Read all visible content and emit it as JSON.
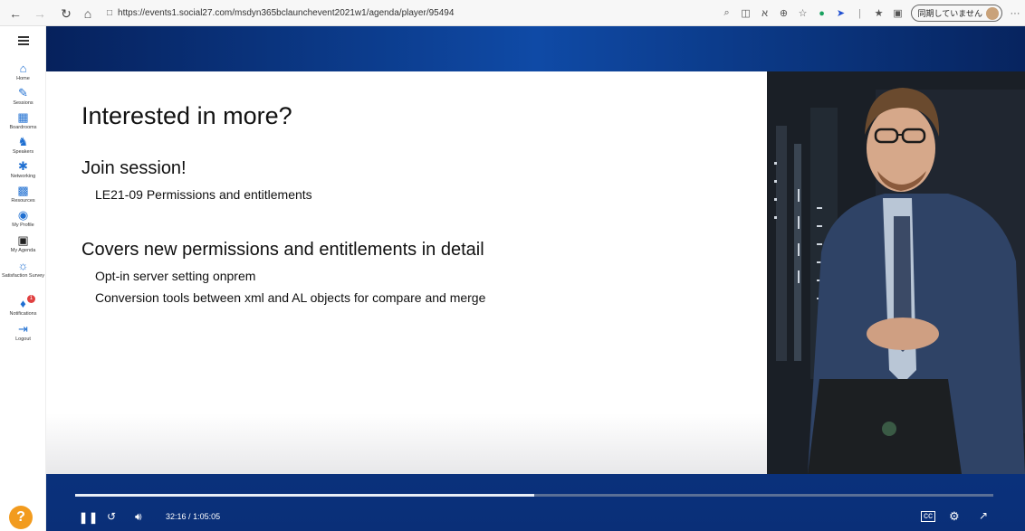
{
  "browser": {
    "url": "https://events1.social27.com/msdyn365bclaunchevent2021w1/agenda/player/95494",
    "sync_label": "同期していません",
    "more_label": "···"
  },
  "sidebar": {
    "items": [
      {
        "label": "Home",
        "icon": "home-icon"
      },
      {
        "label": "Sessions",
        "icon": "pencil-icon"
      },
      {
        "label": "Boardrooms",
        "icon": "boardroom-icon"
      },
      {
        "label": "Speakers",
        "icon": "speaker-icon"
      },
      {
        "label": "Networking",
        "icon": "network-icon"
      },
      {
        "label": "Resources",
        "icon": "resources-icon"
      },
      {
        "label": "My Profile",
        "icon": "profile-icon"
      },
      {
        "label": "My Agenda",
        "icon": "calendar-icon"
      },
      {
        "label": "Satisfaction Survey",
        "icon": "survey-icon"
      },
      {
        "label": "Notifications",
        "icon": "bell-icon"
      },
      {
        "label": "Logout",
        "icon": "logout-icon"
      }
    ],
    "notification_count": "1",
    "help_label": "?"
  },
  "slide": {
    "title": "Interested in more?",
    "heading1": "Join session!",
    "bullet1": "LE21-09 Permissions and entitlements",
    "heading2": "Covers new permissions and entitlements in detail",
    "bullet2": "Opt-in server setting onprem",
    "bullet3": "Conversion tools between xml and AL objects for compare and merge"
  },
  "player": {
    "time_current": "32:16",
    "time_separator": "/",
    "time_total": "1:05:05",
    "progress": 0.5,
    "accent": "#e63a6f"
  }
}
